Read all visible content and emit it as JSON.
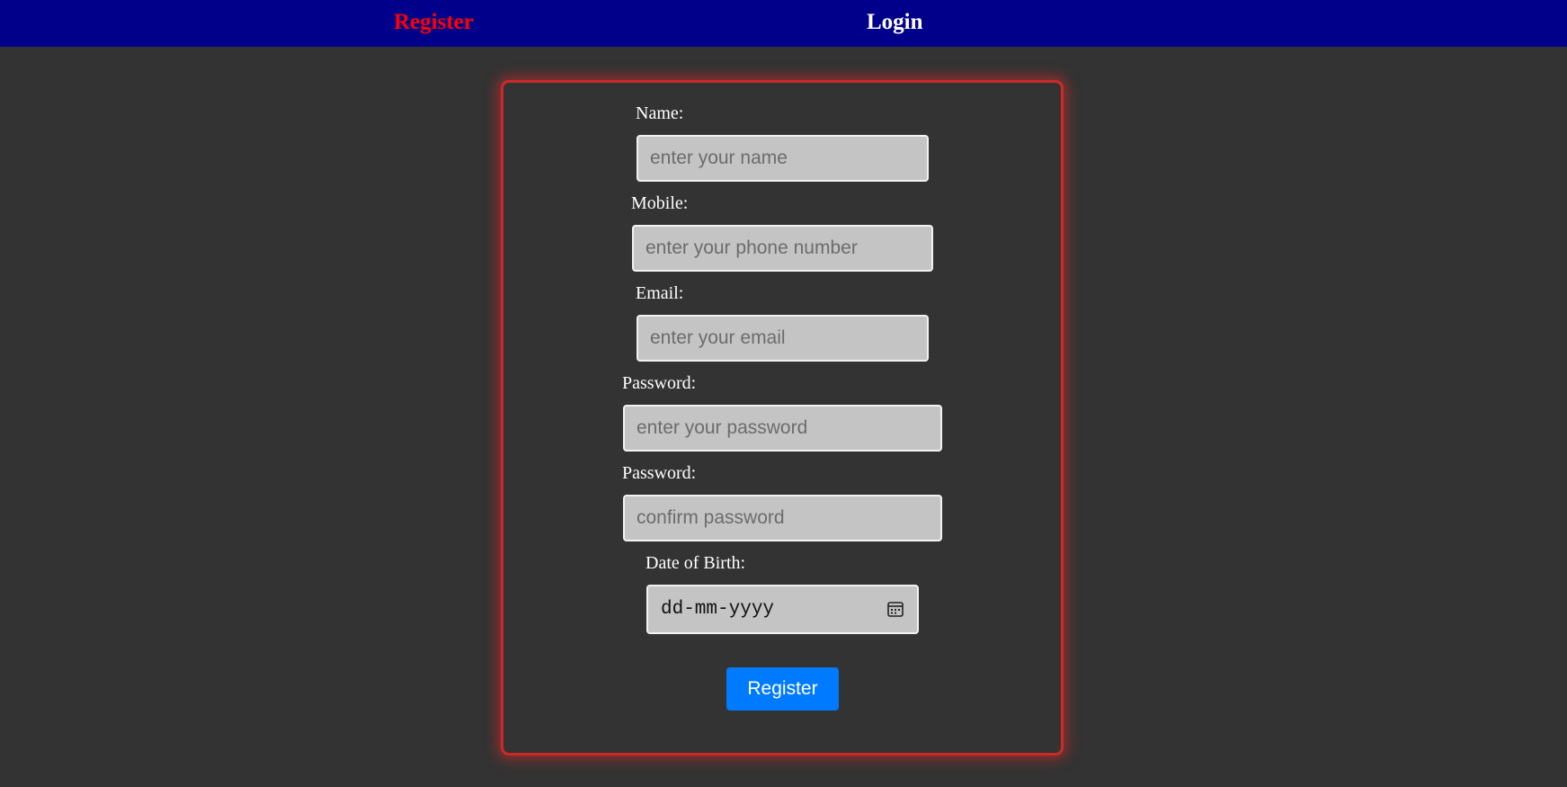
{
  "nav": {
    "register_label": "Register",
    "login_label": "Login"
  },
  "form": {
    "name": {
      "label": "Name:",
      "placeholder": "enter your name",
      "value": ""
    },
    "mobile": {
      "label": "Mobile:",
      "placeholder": "enter your phone number",
      "value": ""
    },
    "email": {
      "label": "Email:",
      "placeholder": "enter your email",
      "value": ""
    },
    "password": {
      "label": "Password:",
      "placeholder": "enter your password",
      "value": ""
    },
    "confirm_password": {
      "label": "Password:",
      "placeholder": "confirm password",
      "value": ""
    },
    "dob": {
      "label": "Date of Birth:",
      "placeholder": "dd-mm-yyyy",
      "icon": "calendar-icon"
    },
    "submit_label": "Register"
  },
  "colors": {
    "navbar": "#00008b",
    "background": "#333333",
    "active_nav": "#ff0000",
    "card_glow": "#cc2a2a",
    "button": "#007bff",
    "input_bg": "#c4c4c4"
  }
}
